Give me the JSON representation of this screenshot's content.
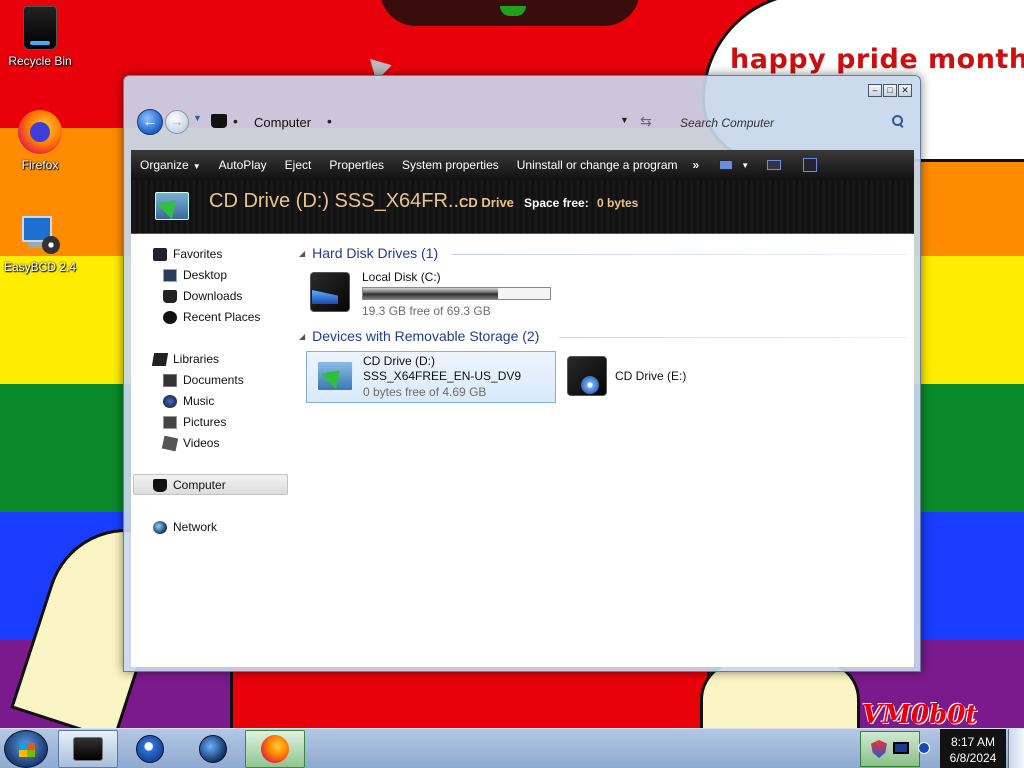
{
  "desktop": {
    "banner_text": "happy pride month",
    "signature_text": "VM0b0t",
    "icons": [
      {
        "label": "Recycle Bin",
        "icon": "recycle-bin-icon"
      },
      {
        "label": "Firefox",
        "icon": "firefox-icon"
      },
      {
        "label": "EasyBCD 2.4",
        "icon": "easybcd-icon"
      }
    ]
  },
  "window": {
    "address": {
      "location": "Computer",
      "search_placeholder": "Search Computer"
    },
    "toolbar": {
      "organize": "Organize",
      "autoplay": "AutoPlay",
      "eject": "Eject",
      "properties": "Properties",
      "system_properties": "System properties",
      "uninstall": "Uninstall or change a program",
      "more": "»"
    },
    "details": {
      "title": "CD Drive (D:) SSS_X64FR...",
      "type": "CD Drive",
      "space_free_label": "Space free:",
      "space_free_value": "0 bytes"
    },
    "nav": {
      "favorites": "Favorites",
      "desktop": "Desktop",
      "downloads": "Downloads",
      "recent_places": "Recent Places",
      "libraries": "Libraries",
      "documents": "Documents",
      "music": "Music",
      "pictures": "Pictures",
      "videos": "Videos",
      "computer": "Computer",
      "network": "Network"
    },
    "groups": {
      "hard_disk": "Hard Disk Drives (1)",
      "removable": "Devices with Removable Storage (2)"
    },
    "drives": {
      "c": {
        "name": "Local Disk (C:)",
        "info": "19.3 GB free of 69.3 GB",
        "used_fraction": 0.72
      },
      "d": {
        "name": "CD Drive (D:)",
        "label": "SSS_X64FREE_EN-US_DV9",
        "info": "0 bytes free of 4.69 GB"
      },
      "e": {
        "name": "CD Drive (E:)"
      }
    }
  },
  "taskbar": {
    "time": "8:17 AM",
    "date": "6/8/2024"
  },
  "colors": {
    "details_text": "#e9c48a",
    "group_header": "#1e3d8c",
    "selection_border": "#84acdd"
  }
}
